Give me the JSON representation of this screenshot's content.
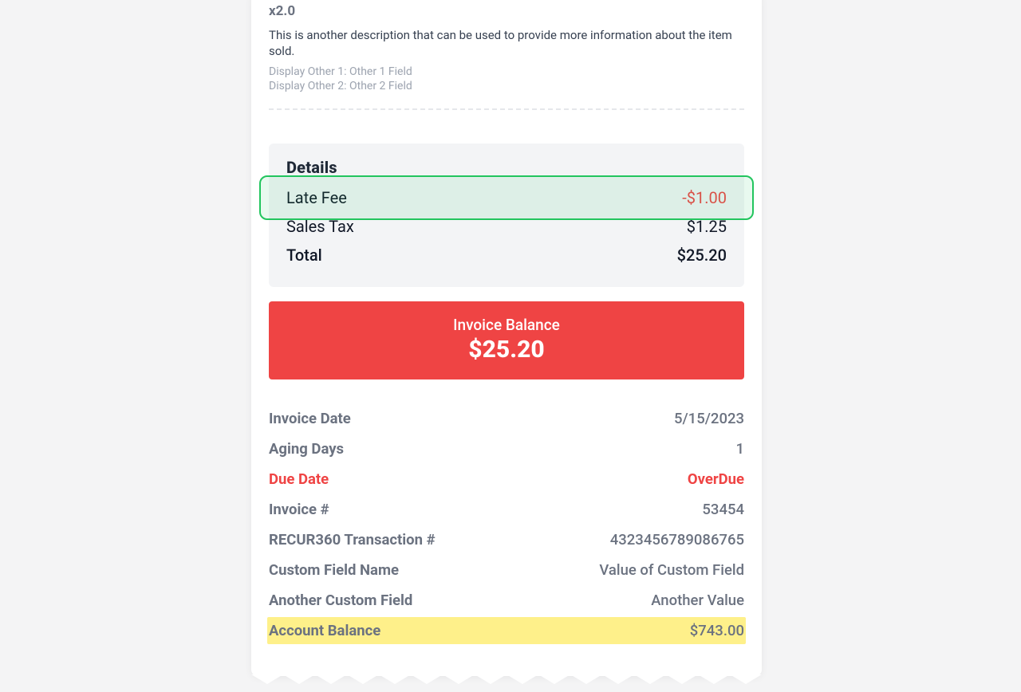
{
  "item": {
    "qty": "x2.0",
    "description": "This is another description that can be used to provide more information about the item sold.",
    "other1": "Display Other 1: Other 1 Field",
    "other2": "Display Other 2: Other 2 Field"
  },
  "details": {
    "title": "Details",
    "late_fee_label": "Late Fee",
    "late_fee_value": "-$1.00",
    "sales_tax_label": "Sales Tax",
    "sales_tax_value": "$1.25",
    "total_label": "Total",
    "total_value": "$25.20"
  },
  "balance": {
    "label": "Invoice Balance",
    "amount": "$25.20"
  },
  "meta": {
    "invoice_date_label": "Invoice Date",
    "invoice_date_value": "5/15/2023",
    "aging_days_label": "Aging Days",
    "aging_days_value": "1",
    "due_date_label": "Due Date",
    "due_date_value": "OverDue",
    "invoice_num_label": "Invoice #",
    "invoice_num_value": "53454",
    "txn_label": "RECUR360 Transaction #",
    "txn_value": "4323456789086765",
    "custom1_label": "Custom Field Name",
    "custom1_value": "Value of Custom Field",
    "custom2_label": "Another Custom Field",
    "custom2_value": "Another Value",
    "account_balance_label": "Account Balance",
    "account_balance_value": "$743.00"
  }
}
